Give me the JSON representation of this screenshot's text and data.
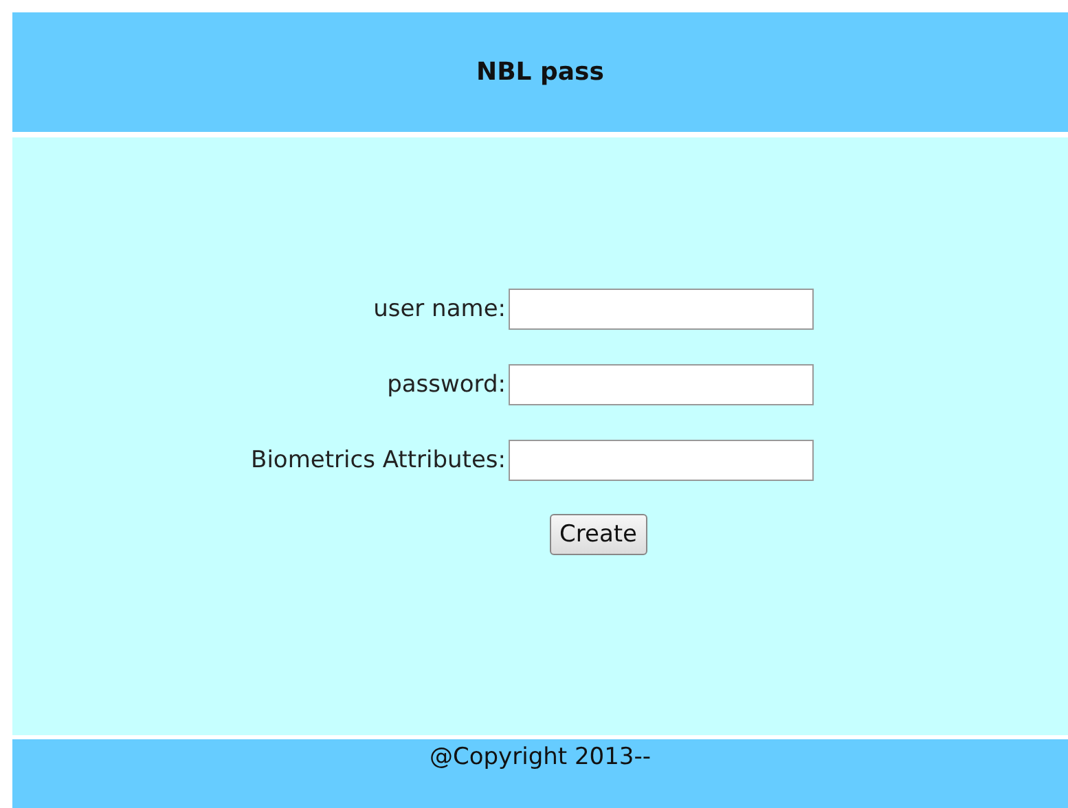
{
  "header": {
    "title": "NBL pass"
  },
  "form": {
    "fields": [
      {
        "label": "user name:"
      },
      {
        "label": "password:"
      },
      {
        "label": "Biometrics Attributes:"
      }
    ],
    "button": "Create"
  },
  "footer": {
    "text": "@Copyright 2013--"
  }
}
